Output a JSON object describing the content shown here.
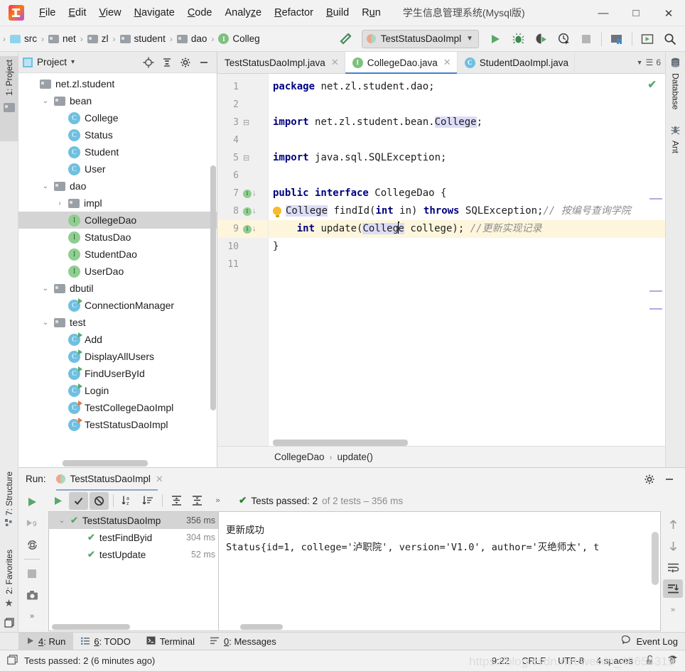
{
  "window": {
    "title": "学生信息管理系统(Mysql版)",
    "minimize": "—",
    "maximize": "□",
    "close": "✕"
  },
  "menu": {
    "items": [
      {
        "label": "File",
        "mnemonic": "F"
      },
      {
        "label": "Edit",
        "mnemonic": "E"
      },
      {
        "label": "View",
        "mnemonic": "V"
      },
      {
        "label": "Navigate",
        "mnemonic": "N"
      },
      {
        "label": "Code",
        "mnemonic": "C"
      },
      {
        "label": "Analyze",
        "mnemonic": "z"
      },
      {
        "label": "Refactor",
        "mnemonic": "R"
      },
      {
        "label": "Build",
        "mnemonic": "B"
      },
      {
        "label": "Run",
        "mnemonic": "u"
      }
    ]
  },
  "navbar": {
    "breadcrumbs": [
      {
        "label": "src",
        "icon": "folder-source-icon"
      },
      {
        "label": "net",
        "icon": "folder-icon"
      },
      {
        "label": "zl",
        "icon": "folder-icon"
      },
      {
        "label": "student",
        "icon": "folder-icon"
      },
      {
        "label": "dao",
        "icon": "folder-icon"
      },
      {
        "label": "Colleg",
        "icon": "interface-icon"
      }
    ],
    "separator": "›",
    "run_configuration": "TestStatusDaoImpl",
    "dropdown_arrow": "⌄",
    "buttons": [
      {
        "name": "build-hammer-icon",
        "title": "Build"
      },
      {
        "name": "run-icon",
        "title": "Run"
      },
      {
        "name": "debug-icon",
        "title": "Debug"
      },
      {
        "name": "run-with-coverage-icon",
        "title": "Run with Coverage"
      },
      {
        "name": "profile-icon",
        "title": "Profile"
      },
      {
        "name": "stop-icon",
        "title": "Stop"
      },
      {
        "name": "project-structure-icon",
        "title": "Project Structure"
      },
      {
        "name": "update-app-icon",
        "title": "Update"
      },
      {
        "name": "search-everywhere-icon",
        "title": "Search Everywhere"
      }
    ]
  },
  "left_strips": {
    "project_tab": "1: Project",
    "structure_tab": "7: Structure",
    "favorites_tab": "2: Favorites"
  },
  "right_strips": {
    "database_tab": "Database",
    "ant_tab": "Ant"
  },
  "project_panel": {
    "title": "Project",
    "dropdown_arrow": "▾",
    "header_buttons": [
      {
        "name": "locate-target-icon"
      },
      {
        "name": "collapse-all-icon"
      },
      {
        "name": "settings-gear-icon"
      },
      {
        "name": "hide-panel-icon"
      }
    ],
    "tree": [
      {
        "label": "net.zl.student",
        "kind": "package",
        "depth": 0,
        "twist": "",
        "selected": false
      },
      {
        "label": "bean",
        "kind": "folder",
        "depth": 1,
        "twist": "⌄",
        "selected": false
      },
      {
        "label": "College",
        "kind": "class",
        "depth": 2,
        "twist": "",
        "selected": false
      },
      {
        "label": "Status",
        "kind": "class",
        "depth": 2,
        "twist": "",
        "selected": false
      },
      {
        "label": "Student",
        "kind": "class",
        "depth": 2,
        "twist": "",
        "selected": false
      },
      {
        "label": "User",
        "kind": "class",
        "depth": 2,
        "twist": "",
        "selected": false
      },
      {
        "label": "dao",
        "kind": "folder",
        "depth": 1,
        "twist": "⌄",
        "selected": false
      },
      {
        "label": "impl",
        "kind": "folder",
        "depth": 2,
        "twist": "›",
        "selected": false
      },
      {
        "label": "CollegeDao",
        "kind": "interface",
        "depth": 2,
        "twist": "",
        "selected": true
      },
      {
        "label": "StatusDao",
        "kind": "interface",
        "depth": 2,
        "twist": "",
        "selected": false
      },
      {
        "label": "StudentDao",
        "kind": "interface",
        "depth": 2,
        "twist": "",
        "selected": false
      },
      {
        "label": "UserDao",
        "kind": "interface",
        "depth": 2,
        "twist": "",
        "selected": false
      },
      {
        "label": "dbutil",
        "kind": "folder",
        "depth": 1,
        "twist": "⌄",
        "selected": false
      },
      {
        "label": "ConnectionManager",
        "kind": "class-run",
        "depth": 2,
        "twist": "",
        "selected": false
      },
      {
        "label": "test",
        "kind": "folder",
        "depth": 1,
        "twist": "⌄",
        "selected": false
      },
      {
        "label": "Add",
        "kind": "class-run",
        "depth": 2,
        "twist": "",
        "selected": false
      },
      {
        "label": "DisplayAllUsers",
        "kind": "class-run",
        "depth": 2,
        "twist": "",
        "selected": false
      },
      {
        "label": "FindUserById",
        "kind": "class-run",
        "depth": 2,
        "twist": "",
        "selected": false
      },
      {
        "label": "Login",
        "kind": "class-run",
        "depth": 2,
        "twist": "",
        "selected": false
      },
      {
        "label": "TestCollegeDaoImpl",
        "kind": "class-test",
        "depth": 2,
        "twist": "",
        "selected": false
      },
      {
        "label": "TestStatusDaoImpl",
        "kind": "class-test",
        "depth": 2,
        "twist": "",
        "selected": false
      }
    ]
  },
  "editor": {
    "tabs": [
      {
        "label": "TestStatusDaoImpl.java",
        "icon": "none",
        "active": false,
        "close": "✕"
      },
      {
        "label": "CollegeDao.java",
        "icon": "interface-icon",
        "active": true,
        "close": "✕"
      },
      {
        "label": "StudentDaoImpl.java",
        "icon": "class-icon",
        "active": false,
        "close": ""
      }
    ],
    "tabs_overflow": "6",
    "inspection_ok": "✔",
    "breadcrumb": [
      "CollegeDao",
      "update()"
    ],
    "breadcrumb_sep": "›",
    "lines": [
      {
        "n": "1",
        "gutter": [],
        "fold": "",
        "highlight": false,
        "tokens": [
          {
            "t": "package ",
            "c": "kw"
          },
          {
            "t": "net.zl.student.dao;",
            "c": "plain"
          }
        ]
      },
      {
        "n": "2",
        "gutter": [],
        "fold": "",
        "highlight": false,
        "tokens": []
      },
      {
        "n": "3",
        "gutter": [],
        "fold": "minus",
        "highlight": false,
        "tokens": [
          {
            "t": "import ",
            "c": "kw"
          },
          {
            "t": "net.zl.student.bean.",
            "c": "plain"
          },
          {
            "t": "College",
            "c": "hlref"
          },
          {
            "t": ";",
            "c": "plain"
          }
        ]
      },
      {
        "n": "4",
        "gutter": [],
        "fold": "",
        "highlight": false,
        "tokens": []
      },
      {
        "n": "5",
        "gutter": [],
        "fold": "minus",
        "highlight": false,
        "tokens": [
          {
            "t": "import ",
            "c": "kw"
          },
          {
            "t": "java.sql.SQLException;",
            "c": "plain"
          }
        ]
      },
      {
        "n": "6",
        "gutter": [],
        "fold": "",
        "highlight": false,
        "tokens": []
      },
      {
        "n": "7",
        "gutter": [
          "implemented"
        ],
        "fold": "",
        "highlight": false,
        "tokens": [
          {
            "t": "public interface ",
            "c": "kw"
          },
          {
            "t": "CollegeDao {",
            "c": "plain"
          }
        ]
      },
      {
        "n": "8",
        "gutter": [
          "implemented"
        ],
        "fold": "",
        "highlight": false,
        "bulb": true,
        "tokens": [
          {
            "t": "College",
            "c": "hlref"
          },
          {
            "t": " findId(",
            "c": "plain"
          },
          {
            "t": "int",
            "c": "kw"
          },
          {
            "t": " in) ",
            "c": "plain"
          },
          {
            "t": "throws",
            "c": "kw"
          },
          {
            "t": " SQLException;",
            "c": "plain"
          },
          {
            "t": "// 按编号查询学院",
            "c": "cmt"
          }
        ]
      },
      {
        "n": "9",
        "gutter": [
          "implemented"
        ],
        "fold": "",
        "highlight": true,
        "tokens": [
          {
            "t": "    ",
            "c": "plain"
          },
          {
            "t": "int",
            "c": "kw"
          },
          {
            "t": " update(",
            "c": "plain"
          },
          {
            "t": "College",
            "c": "hlref-caret"
          },
          {
            "t": " college); ",
            "c": "plain"
          },
          {
            "t": "//更新实现记录",
            "c": "cmt"
          }
        ]
      },
      {
        "n": "10",
        "gutter": [],
        "fold": "",
        "highlight": false,
        "tokens": [
          {
            "t": "}",
            "c": "plain"
          }
        ]
      },
      {
        "n": "11",
        "gutter": [],
        "fold": "",
        "highlight": false,
        "tokens": []
      }
    ]
  },
  "run_panel": {
    "label": "Run:",
    "tab_name": "TestStatusDaoImpl",
    "tab_close": "✕",
    "settings_icon": "gear-icon",
    "hide_icon": "hide-panel-icon",
    "left_tools": [
      {
        "name": "rerun-icon"
      },
      {
        "name": "rerun-failed-tests-icon"
      },
      {
        "name": "toggle-auto-test-icon"
      },
      {
        "name": "stop-icon"
      },
      {
        "name": "dump-threads-icon"
      },
      {
        "name": "expand-more-icon"
      }
    ],
    "test_toolbar": [
      {
        "name": "expand-all-icon"
      },
      {
        "name": "show-passed-icon",
        "active": true
      },
      {
        "name": "show-ignored-icon",
        "active": true
      },
      {
        "name": "sort-alphabetically-icon"
      },
      {
        "name": "sort-by-duration-icon"
      },
      {
        "name": "expand-tree-icon"
      },
      {
        "name": "collapse-tree-icon"
      },
      {
        "name": "more-icon"
      }
    ],
    "status": {
      "check": "✔",
      "passed_text": "Tests passed: 2",
      "of_text": "of 2 tests – 356 ms"
    },
    "test_tree": [
      {
        "label": "TestStatusDaoImp",
        "time": "356 ms",
        "depth": 0,
        "twist": "⌄",
        "selected": true
      },
      {
        "label": "testFindByid",
        "time": "304 ms",
        "depth": 1,
        "twist": "",
        "selected": false
      },
      {
        "label": "testUpdate",
        "time": "52 ms",
        "depth": 1,
        "twist": "",
        "selected": false
      }
    ],
    "console_lines": [
      "更新成功",
      "Status{id=1, college='泸职院', version='V1.0', author='灭绝师太', t"
    ],
    "right_tools": [
      {
        "name": "scroll-up-icon"
      },
      {
        "name": "scroll-down-icon"
      },
      {
        "name": "soft-wrap-icon"
      },
      {
        "name": "scroll-to-end-icon",
        "active": true
      },
      {
        "name": "more-icon"
      }
    ]
  },
  "toolwindow_bar": {
    "items": [
      {
        "label": "4: Run",
        "mnemonic": "4",
        "icon": "run-icon",
        "active": true
      },
      {
        "label": "6: TODO",
        "mnemonic": "6",
        "icon": "todo-icon",
        "active": false
      },
      {
        "label": "Terminal",
        "mnemonic": "",
        "icon": "terminal-icon",
        "active": false
      },
      {
        "label": "0: Messages",
        "mnemonic": "0",
        "icon": "messages-icon",
        "active": false
      }
    ],
    "event_log": "Event Log",
    "event_log_icon": "balloon-icon"
  },
  "statusbar": {
    "message": "Tests passed: 2 (6 minutes ago)",
    "message_icon": "window-icon",
    "caret_position": "9:22",
    "line_separator": "CRLF",
    "encoding": "UTF-8",
    "indent": "4 spaces",
    "lock_icon": "unlock-icon",
    "inspection_icon": "hector-icon",
    "watermark": "https://blog.csdn.net/weixin_45654319"
  },
  "colors": {
    "accent": "#4083c9",
    "green": "#59a869",
    "keyword": "#000080",
    "comment": "#8c8c8c",
    "highlight_ref": "#dcdcf7",
    "line_highlight": "#fdf6dd"
  }
}
